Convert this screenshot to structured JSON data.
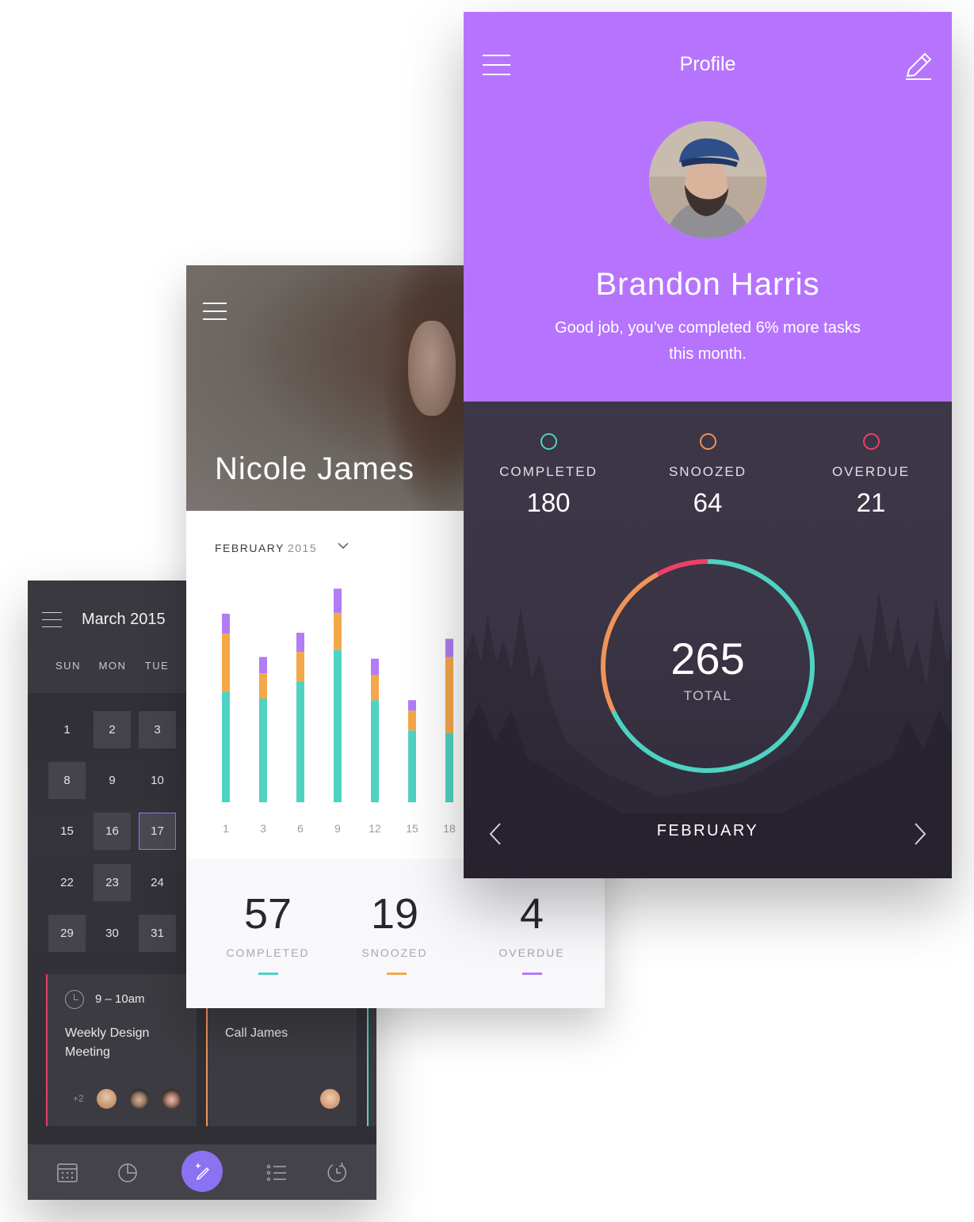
{
  "calendar": {
    "month_title": "March 2015",
    "weekdays": [
      "SUN",
      "MON",
      "TUE"
    ],
    "days": [
      "1",
      "2",
      "3",
      "8",
      "9",
      "10",
      "15",
      "16",
      "17",
      "22",
      "23",
      "24",
      "29",
      "30",
      "31"
    ],
    "event1": {
      "time": "9 – 10am",
      "title": "Weekly Design Meeting",
      "extra_count": "+2"
    },
    "event2": {
      "title": "Call James"
    },
    "icons": [
      "calendar-grid-icon",
      "pie-chart-icon",
      "edit-icon",
      "list-icon",
      "history-icon"
    ],
    "accent": "#8a72f2"
  },
  "stats": {
    "name": "Nicole James",
    "month": "FEBRUARY",
    "year": "2015",
    "totals": [
      {
        "value": "57",
        "label": "COMPLETED",
        "color": "#4fd2c2"
      },
      {
        "value": "19",
        "label": "SNOOZED",
        "color": "#f5a84a"
      },
      {
        "value": "4",
        "label": "OVERDUE",
        "color": "#b27cf4"
      }
    ]
  },
  "chart_data": {
    "type": "bar",
    "stacked": true,
    "categories": [
      "1",
      "3",
      "6",
      "9",
      "12",
      "15",
      "18"
    ],
    "series": [
      {
        "color": "#4fd2c2",
        "values": [
          128,
          120,
          140,
          176,
          118,
          83,
          80
        ]
      },
      {
        "color": "#f5a84a",
        "values": [
          67,
          29,
          34,
          43,
          29,
          23,
          88
        ]
      },
      {
        "color": "#b27cf4",
        "values": [
          23,
          19,
          22,
          28,
          19,
          12,
          21
        ]
      }
    ],
    "ylim": [
      0,
      250
    ],
    "grid": false
  },
  "profile": {
    "title": "Profile",
    "name": "Brandon Harris",
    "message": "Good job, you’ve completed 6% more tasks this month.",
    "stats": [
      {
        "label": "COMPLETED",
        "value": "180",
        "color": "#4fd2c2"
      },
      {
        "label": "SNOOZED",
        "value": "64",
        "color": "#f0935a"
      },
      {
        "label": "OVERDUE",
        "value": "21",
        "color": "#ef3f6b"
      }
    ],
    "total": "265",
    "total_label": "TOTAL",
    "month": "FEBRUARY",
    "accent": "#b674fe"
  }
}
